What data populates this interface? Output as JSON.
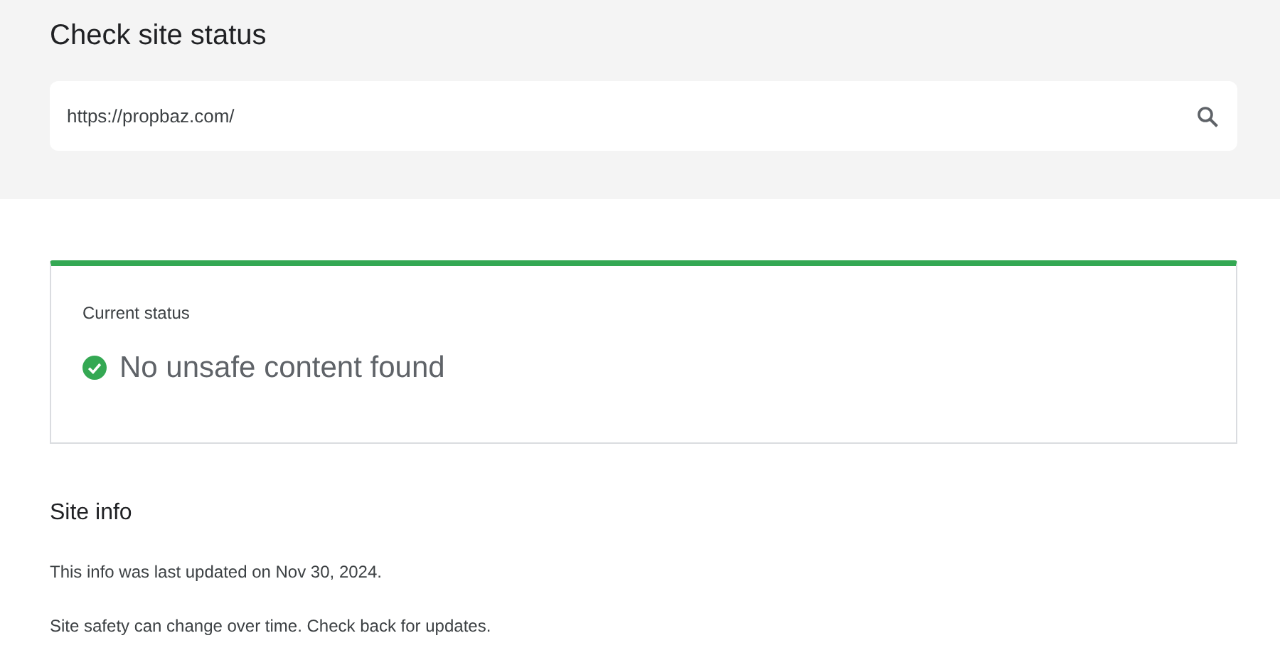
{
  "header": {
    "title": "Check site status",
    "search": {
      "value": "https://propbaz.com/"
    }
  },
  "status_card": {
    "label": "Current status",
    "safe": true,
    "message": "No unsafe content found"
  },
  "site_info": {
    "title": "Site info",
    "lines": [
      "This info was last updated on Nov 30, 2024.",
      "Site safety can change over time. Check back for updates."
    ]
  }
}
